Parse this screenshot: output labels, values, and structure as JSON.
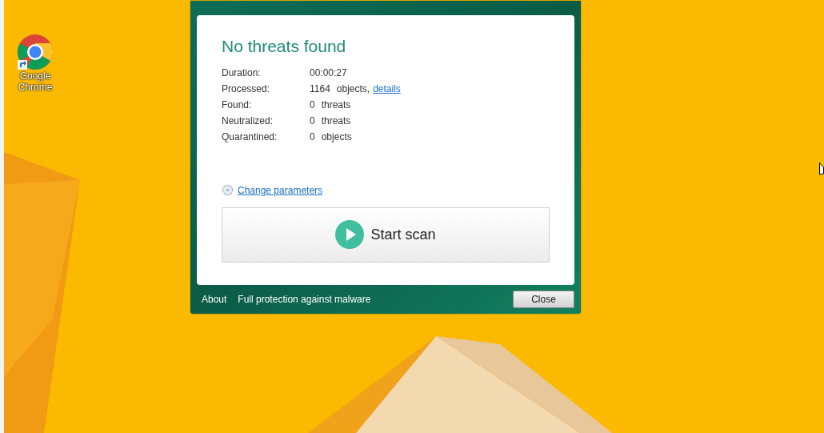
{
  "desktop_icons": [
    {
      "label": "Google Chrome"
    }
  ],
  "dialog": {
    "heading": "No threats found",
    "stats": [
      {
        "label": "Duration:",
        "value": "00:00:27"
      },
      {
        "label": "Processed:",
        "value": "1164",
        "unit": "objects,",
        "link": "details"
      },
      {
        "label": "Found:",
        "value": "0",
        "unit": "threats"
      },
      {
        "label": "Neutralized:",
        "value": "0",
        "unit": "threats"
      },
      {
        "label": "Quarantined:",
        "value": "0",
        "unit": "objects"
      }
    ],
    "settings_link": "Change parameters",
    "start_button": "Start scan",
    "footer": {
      "about": "About",
      "description": "Full protection against malware",
      "close_button": "Close"
    }
  }
}
